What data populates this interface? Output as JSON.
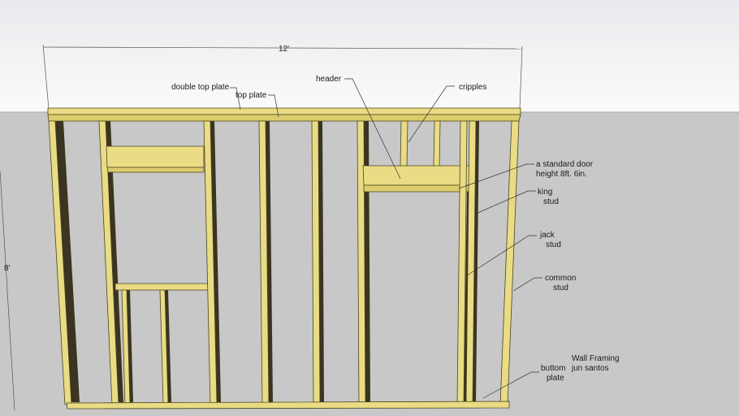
{
  "labels": {
    "width_dim": "12'",
    "height_dim": "8'",
    "double_top_plate": "double top plate",
    "top_plate": "top plate",
    "header": "header",
    "cripples": "cripples",
    "door_line1": "a standard door",
    "door_line2": "height 8ft. 6in.",
    "king_line1": "king",
    "king_line2": "stud",
    "jack_line1": "jack",
    "jack_line2": "stud",
    "common_line1": "common",
    "common_line2": "stud",
    "bottom_line1": "buttom",
    "bottom_line2": "plate",
    "title_line1": "Wall Framing",
    "title_line2": "jun santos"
  },
  "colors": {
    "sky_top": "#f2f3f5",
    "ground": "#c8c8c8",
    "wood": "#e9dc84",
    "wood_edge": "#4a4420"
  }
}
